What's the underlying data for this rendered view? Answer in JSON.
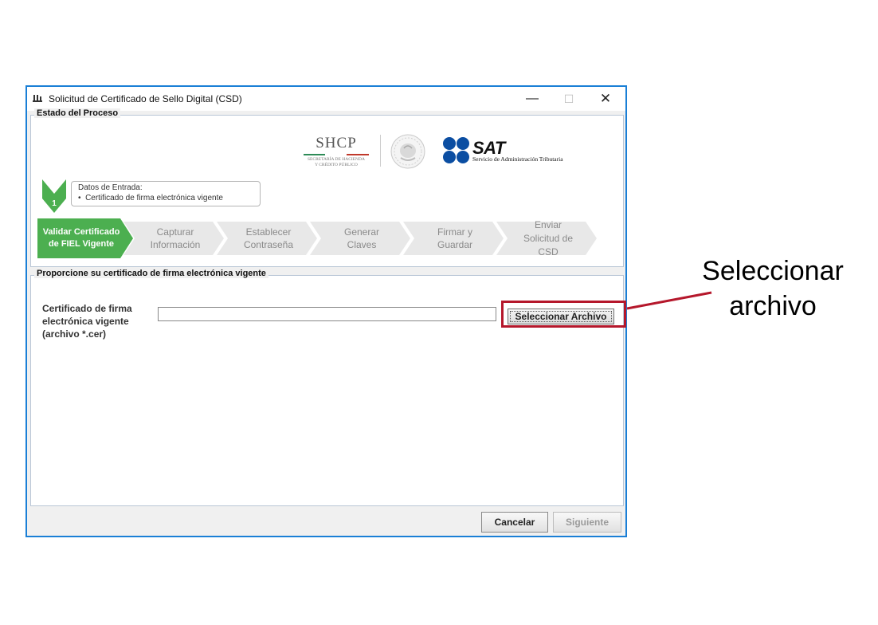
{
  "window": {
    "title": "Solicitud de Certificado de Sello Digital (CSD)",
    "controls": {
      "minimize": "—",
      "maximize": "☐",
      "close": "✕"
    }
  },
  "process": {
    "group_title": "Estado del Proceso",
    "logos": {
      "shcp": "SHCP",
      "shcp_sub_1": "SECRETARÍA DE HACIENDA",
      "shcp_sub_2": "Y CRÉDITO PÚBLICO",
      "sat": "SAT",
      "sat_sub": "Servicio de Administración Tributaria"
    },
    "step_number": "1",
    "entry_data": {
      "title": "Datos de Entrada:",
      "items": [
        "Certificado de firma electrónica vigente"
      ]
    },
    "steps": [
      {
        "label_1": "Validar Certificado",
        "label_2": "de FIEL Vigente",
        "label_3": ""
      },
      {
        "label_1": "Capturar",
        "label_2": "Información",
        "label_3": ""
      },
      {
        "label_1": "Establecer",
        "label_2": "Contraseña",
        "label_3": ""
      },
      {
        "label_1": "Generar",
        "label_2": "Claves",
        "label_3": ""
      },
      {
        "label_1": "Firmar y",
        "label_2": "Guardar",
        "label_3": ""
      },
      {
        "label_1": "Enviar",
        "label_2": "Solicitud de",
        "label_3": "CSD"
      }
    ],
    "active_step": 1
  },
  "certificate": {
    "group_title": "Proporcione su certificado de firma electrónica vigente",
    "field_label_1": "Certificado de firma",
    "field_label_2": "electrónica vigente",
    "field_label_3": "(archivo *.cer)",
    "file_value": "",
    "select_button": "Seleccionar Archivo"
  },
  "footer": {
    "cancel": "Cancelar",
    "next": "Siguiente"
  },
  "annotation": {
    "line_1": "Seleccionar",
    "line_2": "archivo",
    "color": "#b5172b"
  },
  "colors": {
    "active_step": "#4caf50",
    "inactive_step": "#e8e8e8",
    "window_border": "#1a7fd6",
    "sat_blue": "#0b4ea2"
  }
}
